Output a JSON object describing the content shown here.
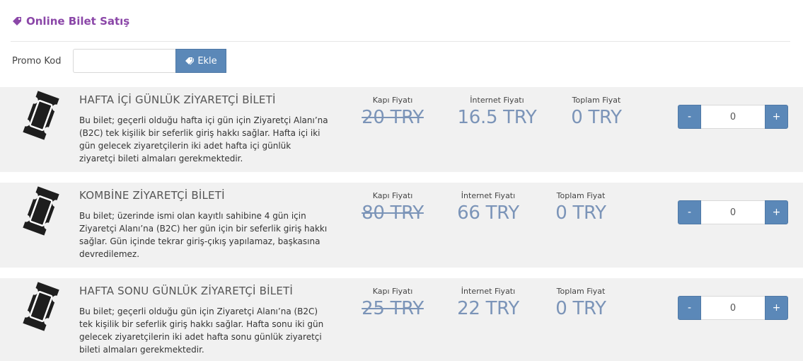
{
  "header": {
    "title": "Online Bilet Satış",
    "icon": "tag-icon",
    "accent": "#8b47a8"
  },
  "promo": {
    "label": "Promo Kod",
    "value": "",
    "placeholder": "",
    "button_label": "Ekle",
    "button_icon": "tags-icon"
  },
  "colors": {
    "button": "#5b88b8",
    "row_bg": "#f1f1f1",
    "price": "#7b94b8"
  },
  "tickets": [
    {
      "name": "HAFTA İÇİ GÜNLÜK ZİYARETÇİ BİLETİ",
      "description": "Bu bilet; geçerli olduğu hafta içi gün için Ziyaretçi Alanı’na (B2C) tek kişilik bir seferlik giriş hakkı sağlar. Hafta içi iki gün gelecek ziyaretçilerin iki adet hafta içi günlük ziyaretçi bileti almaları gerekmektedir.",
      "gate_label": "Kapı Fiyatı",
      "gate_price": "20 TRY",
      "internet_label": "İnternet Fiyatı",
      "internet_price": "16.5 TRY",
      "total_label": "Toplam Fiyat",
      "total_price": "0 TRY",
      "quantity": "0",
      "minus": "-",
      "plus": "+"
    },
    {
      "name": "KOMBİNE ZİYARETÇİ BİLETİ",
      "description": "Bu bilet; üzerinde ismi olan kayıtlı sahibine 4 gün için Ziyaretçi Alanı’na (B2C) her gün için bir seferlik giriş hakkı sağlar. Gün içinde tekrar giriş-çıkış yapılamaz, başkasına devredilemez.",
      "gate_label": "Kapı Fiyatı",
      "gate_price": "80 TRY",
      "internet_label": "İnternet Fiyatı",
      "internet_price": "66 TRY",
      "total_label": "Toplam Fiyat",
      "total_price": "0 TRY",
      "quantity": "0",
      "minus": "-",
      "plus": "+"
    },
    {
      "name": "HAFTA SONU GÜNLÜK ZİYARETÇİ BİLETİ",
      "description": "Bu bilet; geçerli olduğu gün için Ziyaretçi Alanı’na (B2C) tek kişilik bir seferlik giriş hakkı sağlar. Hafta sonu iki gün gelecek ziyaretçilerin iki adet hafta sonu günlük ziyaretçi bileti almaları gerekmektedir.",
      "gate_label": "Kapı Fiyatı",
      "gate_price": "25 TRY",
      "internet_label": "İnternet Fiyatı",
      "internet_price": "22 TRY",
      "total_label": "Toplam Fiyat",
      "total_price": "0 TRY",
      "quantity": "0",
      "minus": "-",
      "plus": "+"
    }
  ]
}
